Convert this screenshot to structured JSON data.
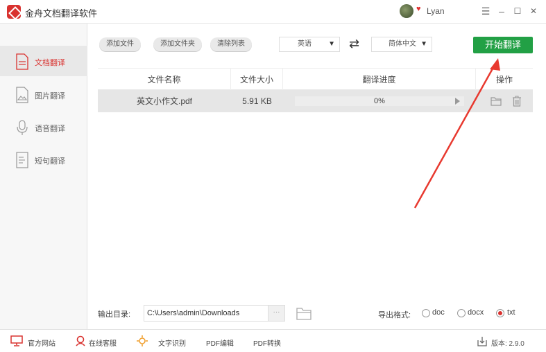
{
  "app": {
    "title": "金舟文档翻译软件"
  },
  "user": {
    "name": "Lyan"
  },
  "window_controls": {
    "menu": "☰",
    "minimize": "–",
    "maximize": "☐",
    "close": "✕"
  },
  "sidebar": {
    "items": [
      {
        "label": "文档翻译",
        "active": true,
        "icon": "document-icon"
      },
      {
        "label": "图片翻译",
        "active": false,
        "icon": "image-icon"
      },
      {
        "label": "语音翻译",
        "active": false,
        "icon": "microphone-icon"
      },
      {
        "label": "短句翻译",
        "active": false,
        "icon": "text-lines-icon"
      }
    ]
  },
  "toolbar": {
    "add_file": "添加文件",
    "add_folder": "添加文件夹",
    "clear_list": "清除列表",
    "source_lang": "英语",
    "target_lang": "简体中文",
    "start": "开始翻译"
  },
  "table": {
    "headers": [
      "文件名称",
      "文件大小",
      "翻译进度",
      "操作"
    ],
    "rows": [
      {
        "name": "英文小作文.pdf",
        "size": "5.91 KB",
        "progress": "0%"
      }
    ]
  },
  "output": {
    "label": "输出目录:",
    "path": "C:\\Users\\admin\\Downloads",
    "more": "···",
    "format_label": "导出格式:",
    "formats": [
      "doc",
      "docx",
      "txt"
    ],
    "selected_format": "txt"
  },
  "footer": {
    "official_site": "官方网站",
    "online_service": "在线客服",
    "ocr": "文字识别",
    "pdf_edit": "PDF编辑",
    "pdf_convert": "PDF转换",
    "version": "版本: 2.9.0"
  },
  "colors": {
    "accent": "#d9322f",
    "primary_button": "#22a045"
  }
}
